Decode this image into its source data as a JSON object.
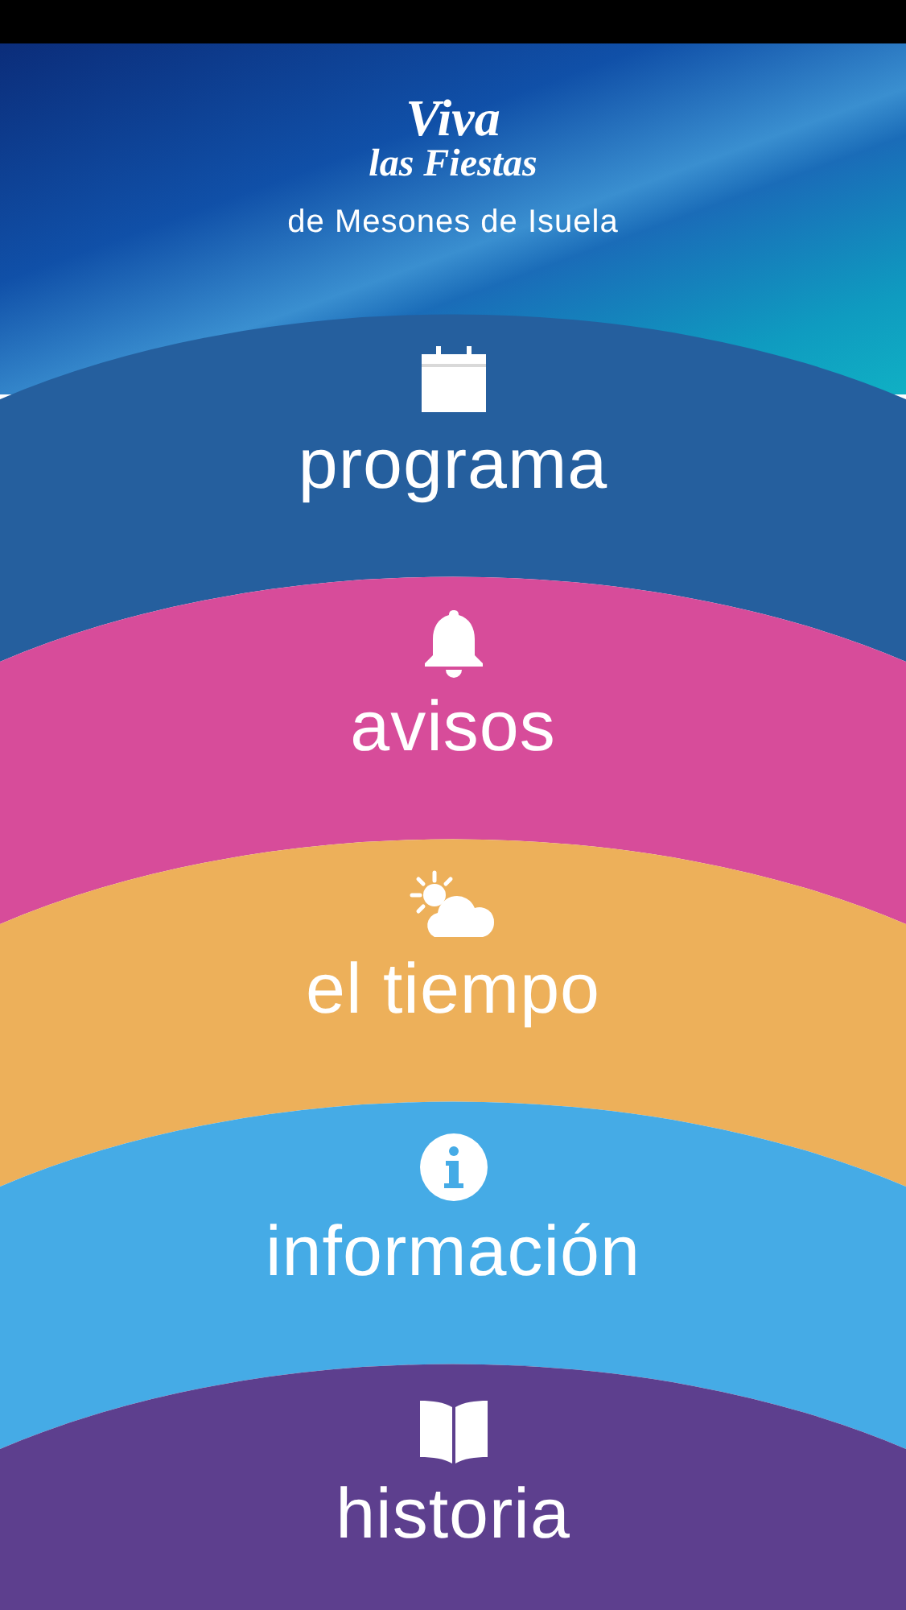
{
  "header": {
    "title_line_1": "Viva",
    "title_line_2": "las Fiestas",
    "subtitle": "de Mesones de Isuela"
  },
  "menu": [
    {
      "kind": "calendar",
      "label": "programa",
      "color": "#255f9e"
    },
    {
      "kind": "bell",
      "label": "avisos",
      "color": "#d74c9a"
    },
    {
      "kind": "weather",
      "label": "el tiempo",
      "color": "#edb05a"
    },
    {
      "kind": "info",
      "label": "información",
      "color": "#45abe6"
    },
    {
      "kind": "book",
      "label": "historia",
      "color": "#5d3f8e"
    }
  ]
}
